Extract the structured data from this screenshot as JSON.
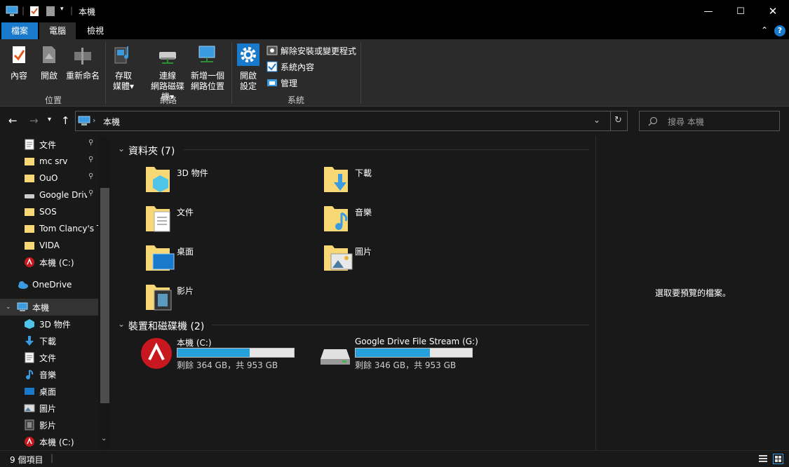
{
  "window": {
    "title": "本機"
  },
  "ribbon_tabs": [
    "檔案",
    "電腦",
    "檢視"
  ],
  "ribbon": {
    "location_group": {
      "label": "位置",
      "buttons": [
        "內容",
        "開啟",
        "重新命名"
      ]
    },
    "network_group": {
      "label": "網路",
      "media_line1": "存取",
      "media_line2": "媒體",
      "map_line1": "連線",
      "map_line2": "網路磁碟機",
      "add_line1": "新增一個",
      "add_line2": "網路位置"
    },
    "system_group": {
      "label": "系統",
      "settings_line1": "開啟",
      "settings_line2": "設定",
      "uninstall": "解除安裝或變更程式",
      "sysprops": "系統內容",
      "manage": "管理"
    }
  },
  "address": {
    "path": "本機",
    "search_placeholder": "搜尋 本機"
  },
  "nav": {
    "quick": [
      "文件",
      "mc srv",
      "OuO",
      "Google Drive",
      "SOS",
      "Tom Clancy's Tl",
      "VIDA",
      "本機 (C:)"
    ],
    "onedrive": "OneDrive",
    "thispc": "本機",
    "pc_items": [
      "3D 物件",
      "下載",
      "文件",
      "音樂",
      "桌面",
      "圖片",
      "影片",
      "本機 (C:)"
    ]
  },
  "folders": {
    "header": "資料夾 (7)",
    "items": [
      "3D 物件",
      "下載",
      "文件",
      "音樂",
      "桌面",
      "圖片",
      "影片"
    ]
  },
  "drives": {
    "header": "裝置和磁碟機 (2)",
    "items": [
      {
        "name": "本機 (C:)",
        "free": "剩餘 364 GB，共 953 GB",
        "used_fraction": 0.618
      },
      {
        "name": "Google Drive File Stream (G:)",
        "free": "剩餘 346 GB，共 953 GB",
        "used_fraction": 0.637
      }
    ]
  },
  "preview": {
    "text": "選取要預覽的檔案。"
  },
  "status": {
    "count": "9 個項目"
  },
  "colors": {
    "accent": "#1979ca",
    "bar_fill": "#26a0da",
    "folder": "#f8d775"
  }
}
